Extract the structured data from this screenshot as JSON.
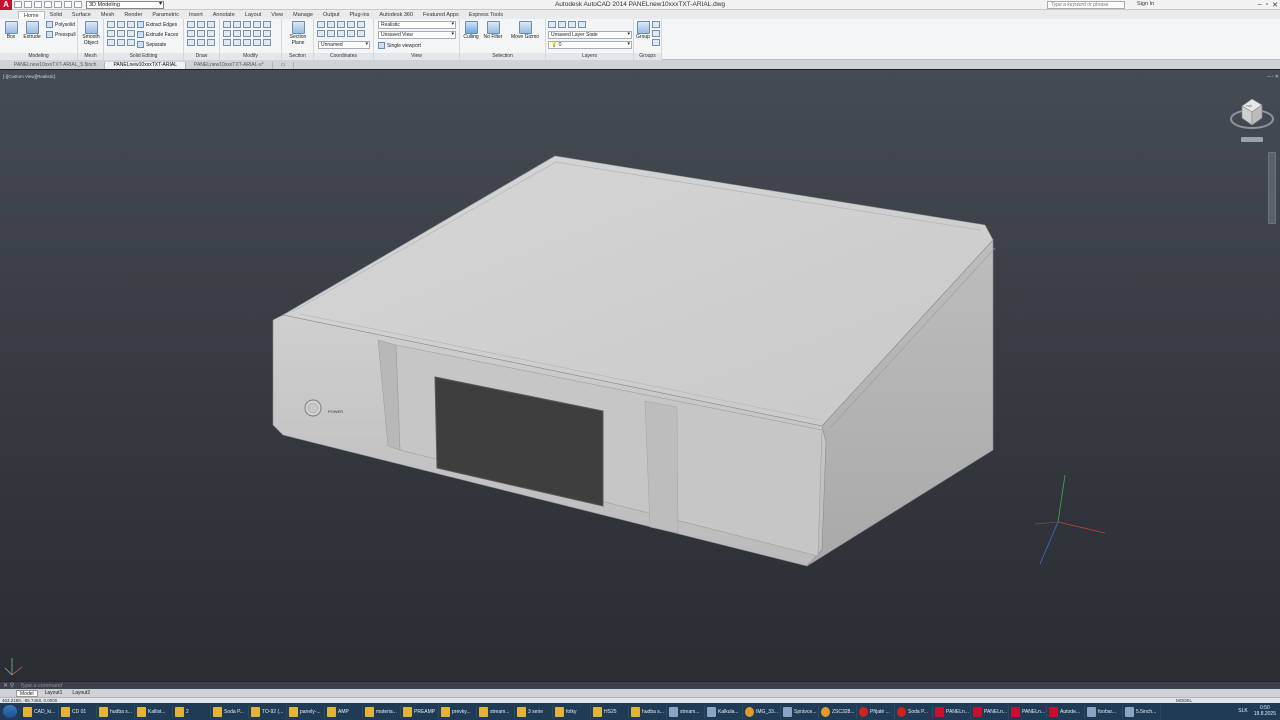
{
  "titlebar": {
    "workspace": "3D Modeling",
    "title": "Autodesk AutoCAD 2014    PANELnew10xxxTXT-ARIAL.dwg",
    "search_placeholder": "Type a keyword or phrase",
    "sign_in": "Sign In"
  },
  "ribbon_tabs": [
    "Home",
    "Solid",
    "Surface",
    "Mesh",
    "Render",
    "Parametric",
    "Insert",
    "Annotate",
    "Layout",
    "View",
    "Manage",
    "Output",
    "Plug-ins",
    "Autodesk 360",
    "Featured Apps",
    "Express Tools"
  ],
  "ribbon": {
    "modeling": {
      "title": "Modeling",
      "box": "Box",
      "extrude": "Extrude",
      "polysolid": "Polysolid",
      "presspull": "Presspull"
    },
    "mesh": {
      "title": "Mesh",
      "smooth_object": "Smooth Object"
    },
    "solid_editing": {
      "title": "Solid Editing",
      "extract_edges": "Extract Edges",
      "extrude_faces": "Extrude Faces",
      "separate": "Separate"
    },
    "draw": {
      "title": "Draw"
    },
    "modify": {
      "title": "Modify"
    },
    "section": {
      "title": "Section",
      "section_plane": "Section Plane"
    },
    "coordinates": {
      "title": "Coordinates",
      "ucs": "Unnamed"
    },
    "view": {
      "title": "View",
      "visual_style": "Realistic",
      "named_view": "Unsaved View",
      "viewport": "Single viewport"
    },
    "selection": {
      "title": "Selection",
      "culling": "Culling",
      "no_filter": "No Filter",
      "move_gizmo": "Move Gizmo"
    },
    "layers": {
      "title": "Layers",
      "layer_state": "Unsaved Layer State",
      "current_layer": "0"
    },
    "groups": {
      "title": "Groups",
      "group": "Group"
    }
  },
  "doc_tabs": [
    "PANELnew10xxxTXT-ARIAL_5.5inch",
    "PANELnew10xxxTXT-ARIAL",
    "PANELnew10xxxTXT-ARIAL-s*"
  ],
  "viewport": {
    "label": "[-][Custom View][Realistic]",
    "viewcube_label": "TOP",
    "device_label": "POWER"
  },
  "command": {
    "prompt": "Type a command"
  },
  "layout_tabs": [
    "Model",
    "Layout1",
    "Layout2"
  ],
  "status": {
    "coords": "463.2189, -85.7468, 0.0000",
    "model": "MODEL"
  },
  "taskbar": {
    "items": [
      {
        "label": "CAD_ki...",
        "kind": "folder"
      },
      {
        "label": "CD 01",
        "kind": "folder"
      },
      {
        "label": "hudba s...",
        "kind": "folder"
      },
      {
        "label": "Kallist...",
        "kind": "folder"
      },
      {
        "label": "2",
        "kind": "folder"
      },
      {
        "label": "Soda P...",
        "kind": "folder"
      },
      {
        "label": "TO-92 (...",
        "kind": "folder"
      },
      {
        "label": "panely-...",
        "kind": "folder"
      },
      {
        "label": "AMP",
        "kind": "folder"
      },
      {
        "label": "materia...",
        "kind": "folder"
      },
      {
        "label": "PREAMP",
        "kind": "folder"
      },
      {
        "label": "prevky...",
        "kind": "folder"
      },
      {
        "label": "stream...",
        "kind": "folder"
      },
      {
        "label": "3 serie",
        "kind": "folder"
      },
      {
        "label": "fotky",
        "kind": "folder"
      },
      {
        "label": "HS25",
        "kind": "folder"
      },
      {
        "label": "hudba s...",
        "kind": "folder"
      },
      {
        "label": "stream...",
        "kind": "doc"
      },
      {
        "label": "Kalkula...",
        "kind": "doc"
      },
      {
        "label": "IMG_33...",
        "kind": "ie"
      },
      {
        "label": "Správce...",
        "kind": "doc"
      },
      {
        "label": "ZSC328...",
        "kind": "ie"
      },
      {
        "label": "Přijaté ...",
        "kind": "red"
      },
      {
        "label": "Soda P...",
        "kind": "red"
      },
      {
        "label": "PANELn...",
        "kind": "acad"
      },
      {
        "label": "PANELn...",
        "kind": "acad"
      },
      {
        "label": "PANELn...",
        "kind": "acad"
      },
      {
        "label": "Autode...",
        "kind": "acad"
      },
      {
        "label": "foobar...",
        "kind": "doc"
      },
      {
        "label": "5.5inch...",
        "kind": "doc"
      }
    ],
    "language": "SLK",
    "time": "0:50",
    "date": "19.8.2025"
  }
}
